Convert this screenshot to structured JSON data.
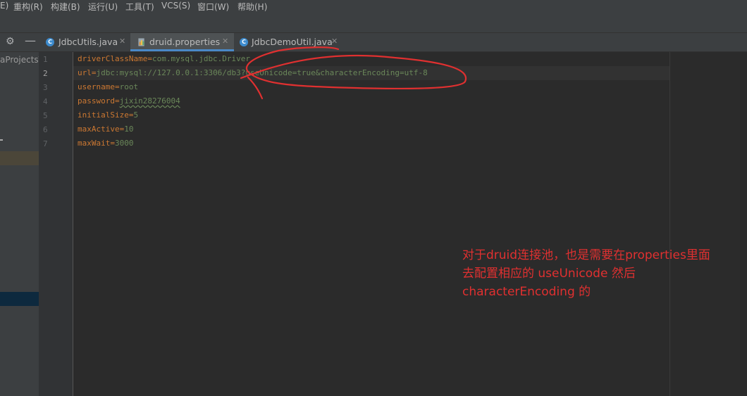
{
  "menu": {
    "items": [
      "E)",
      "重构(R)",
      "构建(B)",
      "运行(U)",
      "工具(T)",
      "VCS(S)",
      "窗口(W)",
      "帮助(H)"
    ]
  },
  "sidebar": {
    "project_label": "aProjects\\"
  },
  "tabs": [
    {
      "label": "JdbcUtils.java",
      "icon": "java-class-icon",
      "active": false
    },
    {
      "label": "druid.properties",
      "icon": "properties-file-icon",
      "active": true
    },
    {
      "label": "JdbcDemoUtil.java",
      "icon": "java-class-icon",
      "active": false
    }
  ],
  "editor": {
    "current_line": 2,
    "lines": [
      {
        "number": "1",
        "key": "driverClassName",
        "eq": "=",
        "value": "com.mysql.jdbc.Driver"
      },
      {
        "number": "2",
        "key": "url",
        "eq": "=",
        "value": "jdbc:mysql://127.0.0.1:3306/db3?useUnicode=true&characterEncoding=utf-8"
      },
      {
        "number": "3",
        "key": "username",
        "eq": "=",
        "value": "root"
      },
      {
        "number": "4",
        "key": "password",
        "eq": "=",
        "value": "jixin28276004"
      },
      {
        "number": "5",
        "key": "initialSize",
        "eq": "=",
        "value": "5"
      },
      {
        "number": "6",
        "key": "maxActive",
        "eq": "=",
        "value": "10"
      },
      {
        "number": "7",
        "key": "maxWait",
        "eq": "=",
        "value": "3000"
      }
    ]
  },
  "annotation": {
    "lines": [
      "对于druid连接池，也是需要在properties里面",
      "去配置相应的  useUnicode  然后",
      "characterEncoding 的"
    ],
    "color": "#e03030"
  }
}
